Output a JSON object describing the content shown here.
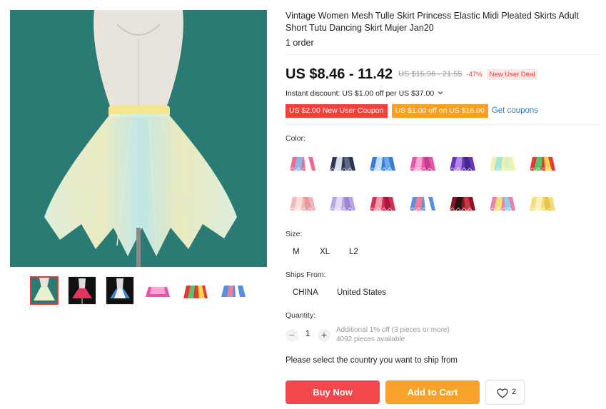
{
  "product": {
    "title": "Vintage Women Mesh Tulle Skirt Princess Elastic Midi Pleated Skirts Adult Short Tutu Dancing Skirt Mujer Jan20",
    "orders": "1 order"
  },
  "pricing": {
    "price": "US $8.46 - 11.42",
    "original_price": "US $15.96 - 21.55",
    "discount_percent": "-47%",
    "deal_badge": "New User Deal",
    "instant_discount": "Instant discount: US $1.00 off per US $37.00",
    "coupon_new_user": "US $2.00 New User Coupon",
    "coupon_store": "US $1.00 off on US $16.00",
    "get_coupons": "Get coupons"
  },
  "colors": {
    "label": "Color:",
    "swatches": [
      {
        "name": "skirt-variant-1",
        "c1": "#f06b8f",
        "c2": "#8fb7ea",
        "c3": "#ffffff"
      },
      {
        "name": "skirt-variant-2",
        "c1": "#2d3550",
        "c2": "#d8dde8",
        "c3": "#5d6a88"
      },
      {
        "name": "skirt-variant-3",
        "c1": "#3a7bd5",
        "c2": "#bfe0f8",
        "c3": "#6ea8e8"
      },
      {
        "name": "skirt-variant-4",
        "c1": "#e855a8",
        "c2": "#f7a8d4",
        "c3": "#c53c8c"
      },
      {
        "name": "skirt-variant-5",
        "c1": "#6a35b8",
        "c2": "#b28ae6",
        "c3": "#3f2a8a"
      },
      {
        "name": "skirt-variant-6",
        "c1": "#f6f0a8",
        "c2": "#a8e4d8",
        "c3": "#d9f2c4"
      },
      {
        "name": "skirt-variant-7",
        "c1": "#e53935",
        "c2": "#56c46a",
        "c3": "#f6d84a"
      },
      {
        "name": "skirt-variant-8",
        "c1": "#f2b5b8",
        "c2": "#fbe0de",
        "c3": "#e79aa0"
      },
      {
        "name": "skirt-variant-9",
        "c1": "#b9a6e2",
        "c2": "#e4dbf6",
        "c3": "#9b85cf"
      },
      {
        "name": "skirt-variant-10",
        "c1": "#d92f57",
        "c2": "#f29ab0",
        "c3": "#a6193b"
      },
      {
        "name": "skirt-variant-11",
        "c1": "#5b8fe0",
        "c2": "#f07f9d",
        "c3": "#ffffff"
      },
      {
        "name": "skirt-variant-12",
        "c1": "#8a1525",
        "c2": "#2b0f14",
        "c3": "#c9374a"
      },
      {
        "name": "skirt-variant-13",
        "c1": "#ec7fb0",
        "c2": "#f5e07a",
        "c3": "#8fd3e8"
      },
      {
        "name": "skirt-variant-14",
        "c1": "#f4dc78",
        "c2": "#fbefc0",
        "c3": "#e8c44c"
      }
    ]
  },
  "sizes": {
    "label": "Size:",
    "options": [
      "M",
      "XL",
      "L2"
    ]
  },
  "ships_from": {
    "label": "Ships From:",
    "options": [
      "CHINA",
      "United States"
    ]
  },
  "quantity": {
    "label": "Quantity:",
    "value": "1",
    "minus": "−",
    "plus": "+",
    "note_discount": "Additional 1% off (3 pieces or more)",
    "note_stock": "4092 pieces available"
  },
  "shipping_message": "Please select the country you want to ship from",
  "actions": {
    "buy_now": "Buy Now",
    "add_to_cart": "Add to Cart",
    "wishlist_count": "2"
  },
  "theme": {
    "accent_red": "#f4474d",
    "accent_orange": "#f9a22b",
    "link_blue": "#2b7ec2",
    "gallery_background": "#2a7b74"
  }
}
